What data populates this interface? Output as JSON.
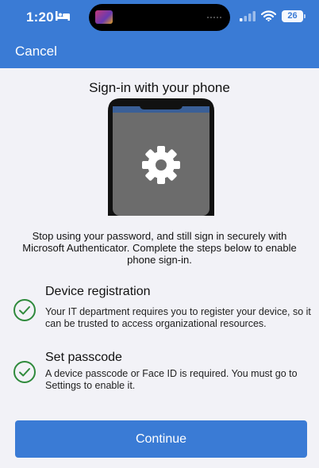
{
  "status_bar": {
    "time": "1:20",
    "battery": "26"
  },
  "header": {
    "cancel_label": "Cancel"
  },
  "main": {
    "title": "Sign-in with your phone",
    "description": "Stop using your password, and still sign in securely with Microsoft Authenticator. Complete the steps below to enable phone sign-in.",
    "steps": [
      {
        "title": "Device registration",
        "description": "Your IT department requires you to register your device, so it can be trusted to access organizational resources."
      },
      {
        "title": "Set passcode",
        "description": "A device passcode or Face ID is required. You must go to Settings to enable it."
      }
    ],
    "continue_label": "Continue"
  },
  "colors": {
    "accent": "#3a7bd5",
    "check": "#2f8a3c",
    "background": "#f2f2f7"
  },
  "icons": [
    "bed-icon",
    "signal-icon",
    "wifi-icon",
    "battery-icon",
    "gear-icon",
    "check-circle-icon"
  ]
}
